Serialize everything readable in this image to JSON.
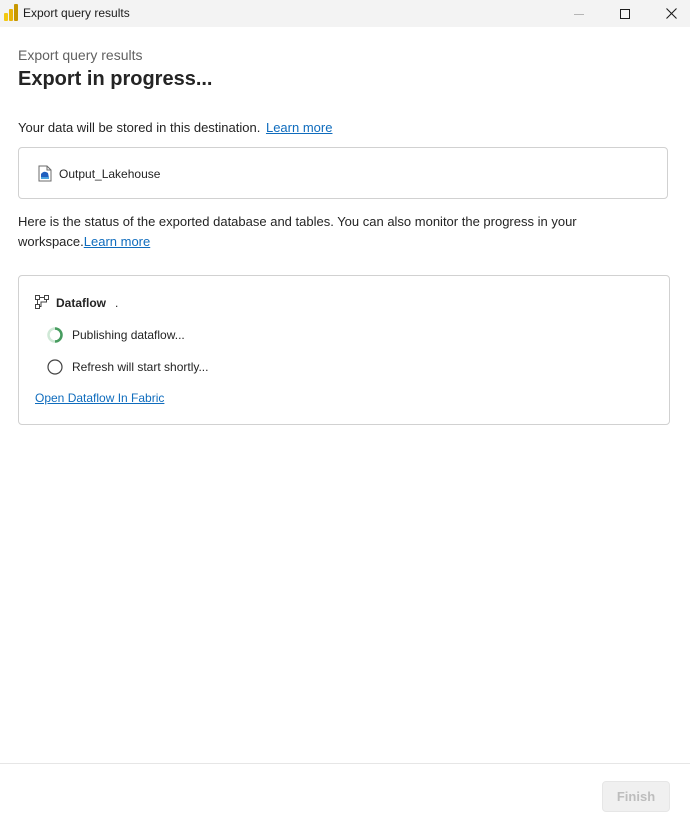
{
  "window": {
    "title": "Export query results"
  },
  "header": {
    "subtitle": "Export query results",
    "title": "Export in progress..."
  },
  "destination": {
    "intro": "Your data will be stored in this destination.",
    "learn_more": "Learn more",
    "name": "Output_Lakehouse",
    "icon": "lakehouse-icon"
  },
  "status": {
    "intro": "Here is the status of the exported database and tables. You can also monitor the progress in your workspace.",
    "learn_more": "Learn more",
    "section_title": "Dataflow",
    "section_suffix": ".",
    "steps": [
      {
        "label": "Publishing dataflow...",
        "state": "in-progress"
      },
      {
        "label": "Refresh will start shortly...",
        "state": "pending"
      }
    ],
    "open_link": "Open Dataflow In Fabric"
  },
  "footer": {
    "finish_label": "Finish"
  },
  "colors": {
    "accent": "#0f6cbd",
    "spinner": "#479c5f",
    "title_bar": "#f3f3f3",
    "border": "#d1d1d1",
    "disabled_text": "#bdbdbd"
  }
}
